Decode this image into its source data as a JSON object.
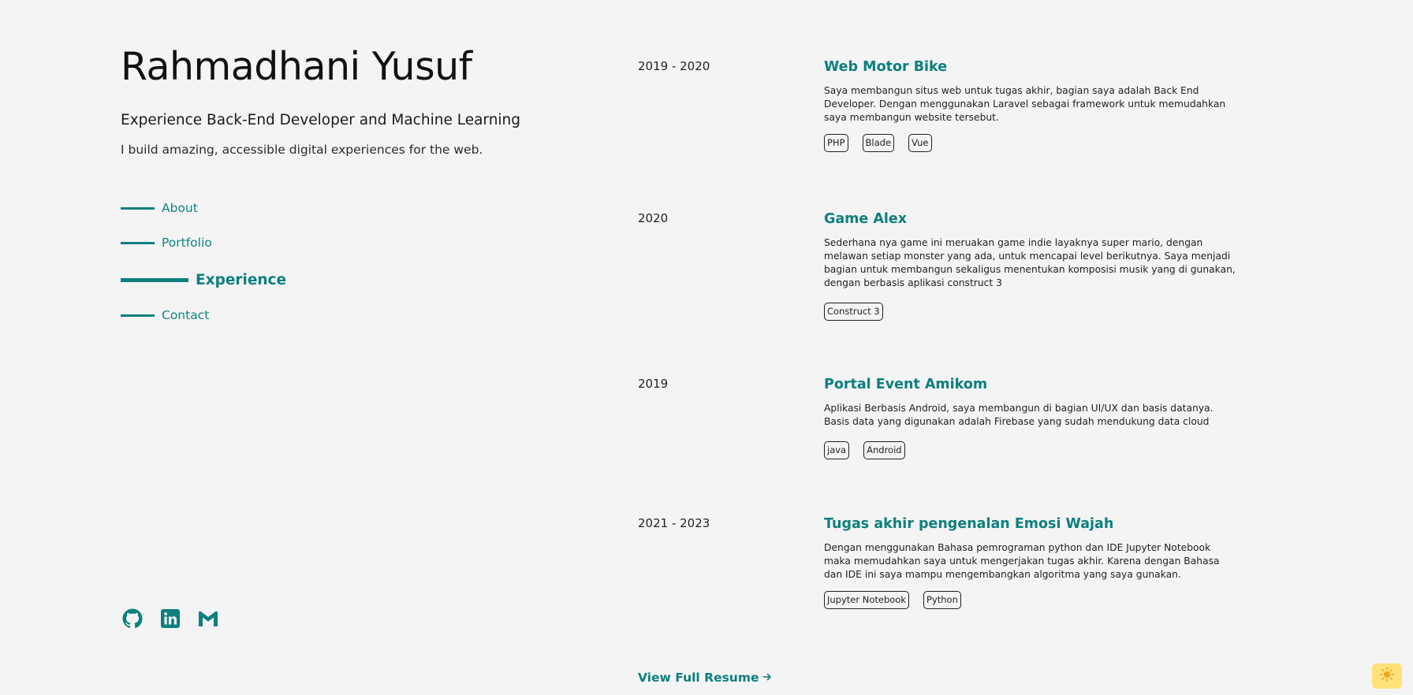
{
  "header": {
    "name": "Rahmadhani Yusuf",
    "role": "Experience Back-End Developer and Machine Learning",
    "tagline": "I build amazing, accessible digital experiences for the web."
  },
  "nav": {
    "items": [
      {
        "label": "About",
        "active": false
      },
      {
        "label": "Portfolio",
        "active": false
      },
      {
        "label": "Experience",
        "active": true
      },
      {
        "label": "Contact",
        "active": false
      }
    ]
  },
  "socials": [
    {
      "icon": "github-icon"
    },
    {
      "icon": "linkedin-icon"
    },
    {
      "icon": "gmail-icon"
    }
  ],
  "experience": [
    {
      "period": "2019 - 2020",
      "title": "Web Motor Bike",
      "description": "Saya membangun situs web untuk tugas akhir, bagian saya adalah Back End Developer. Dengan menggunakan Laravel sebagai framework untuk memudahkan saya membangun website tersebut.",
      "tags": [
        "PHP",
        "Blade",
        "Vue"
      ]
    },
    {
      "period": "2020",
      "title": "Game Alex",
      "description": "Sederhana nya game ini meruakan game indie layaknya super mario, dengan melawan setiap monster yang ada, untuk mencapai level berikutnya. Saya menjadi bagian untuk membangun sekaligus menentukan komposisi musik yang di gunakan, dengan berbasis aplikasi construct 3",
      "tags": [
        "Construct 3"
      ]
    },
    {
      "period": "2019",
      "title": "Portal Event Amikom",
      "description": "Aplikasi Berbasis Android, saya membangun di bagian UI/UX dan basis datanya. Basis data yang digunakan adalah Firebase yang sudah mendukung data cloud",
      "tags": [
        "java",
        "Android"
      ]
    },
    {
      "period": "2021 - 2023",
      "title": "Tugas akhir pengenalan Emosi Wajah",
      "description": "Dengan menggunakan Bahasa pemrograman python dan IDE Jupyter Notebook maka memudahkan saya untuk mengerjakan tugas akhir. Karena dengan Bahasa dan IDE ini saya mampu mengembangkan algoritma yang saya gunakan.",
      "tags": [
        "Jupyter Notebook",
        "Python"
      ]
    }
  ],
  "resume_link": {
    "label": "View Full Resume",
    "icon": "arrow-right-icon"
  },
  "theme_toggle": {
    "icon": "sun-icon"
  },
  "colors": {
    "accent": "#0d7f7f",
    "background": "#f4f4f4",
    "toggle": "#ffe27a"
  }
}
